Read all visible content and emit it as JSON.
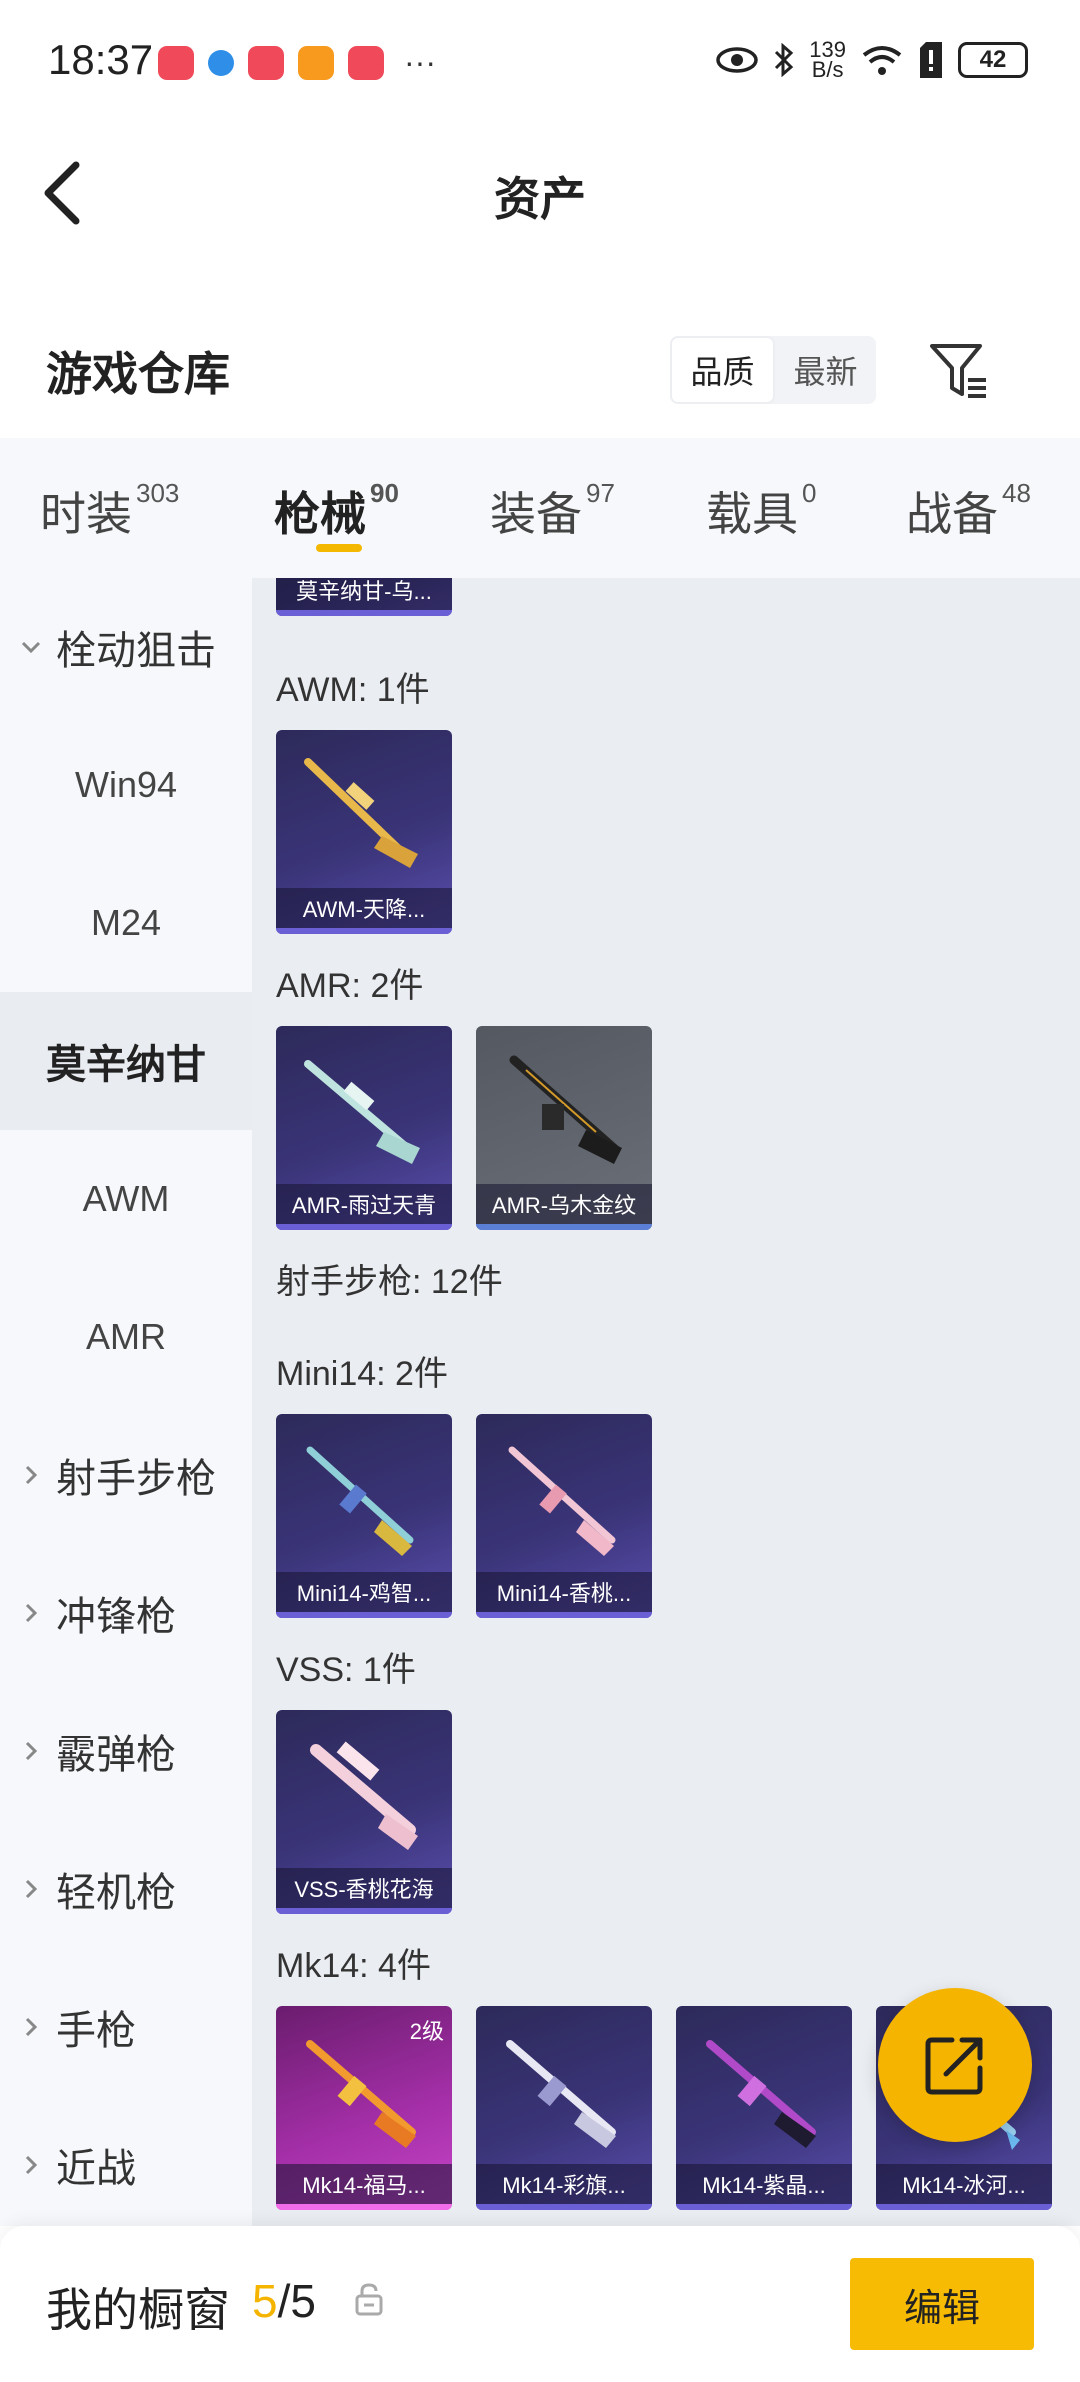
{
  "status_bar": {
    "time": "18:37",
    "network_speed_top": "139",
    "network_speed_bottom": "B/s",
    "battery": "42",
    "more": "···"
  },
  "header": {
    "title": "资产"
  },
  "section": {
    "title": "游戏仓库",
    "sort_quality": "品质",
    "sort_newest": "最新"
  },
  "tabs": [
    {
      "label": "时装",
      "count": "303"
    },
    {
      "label": "枪械",
      "count": "90"
    },
    {
      "label": "装备",
      "count": "97"
    },
    {
      "label": "载具",
      "count": "0"
    },
    {
      "label": "战备",
      "count": "48"
    }
  ],
  "sidebar": {
    "items": [
      {
        "label": "栓动狙击"
      },
      {
        "label": "Win94"
      },
      {
        "label": "M24"
      },
      {
        "label": "莫辛纳甘"
      },
      {
        "label": "AWM"
      },
      {
        "label": "AMR"
      },
      {
        "label": "射手步枪"
      },
      {
        "label": "冲锋枪"
      },
      {
        "label": "霰弹枪"
      },
      {
        "label": "轻机枪"
      },
      {
        "label": "手枪"
      },
      {
        "label": "近战"
      }
    ]
  },
  "content": {
    "partial_card_label": "莫辛纳甘-乌...",
    "groups": [
      {
        "label": "AWM: 1件"
      },
      {
        "label": "AMR: 2件"
      },
      {
        "label": "射手步枪: 12件"
      },
      {
        "label": "Mini14: 2件"
      },
      {
        "label": "VSS: 1件"
      },
      {
        "label": "Mk14: 4件"
      }
    ],
    "cards": [
      {
        "label": "AWM-天降..."
      },
      {
        "label": "AMR-雨过天青"
      },
      {
        "label": "AMR-乌木金纹"
      },
      {
        "label": "Mini14-鸡智..."
      },
      {
        "label": "Mini14-香桃..."
      },
      {
        "label": "VSS-香桃花海"
      },
      {
        "label": "Mk14-福马...",
        "level": "2级"
      },
      {
        "label": "Mk14-彩旗..."
      },
      {
        "label": "Mk14-紫晶..."
      },
      {
        "label": "Mk14-冰河..."
      }
    ]
  },
  "bottom_bar": {
    "label": "我的橱窗",
    "count_current": "5",
    "count_total": "/5",
    "edit": "编辑"
  },
  "colors": {
    "accent": "#f5b400",
    "card_purple": "#3a3478",
    "sidebar_bg": "#f6f8fb",
    "content_bg": "#eaedf2"
  }
}
